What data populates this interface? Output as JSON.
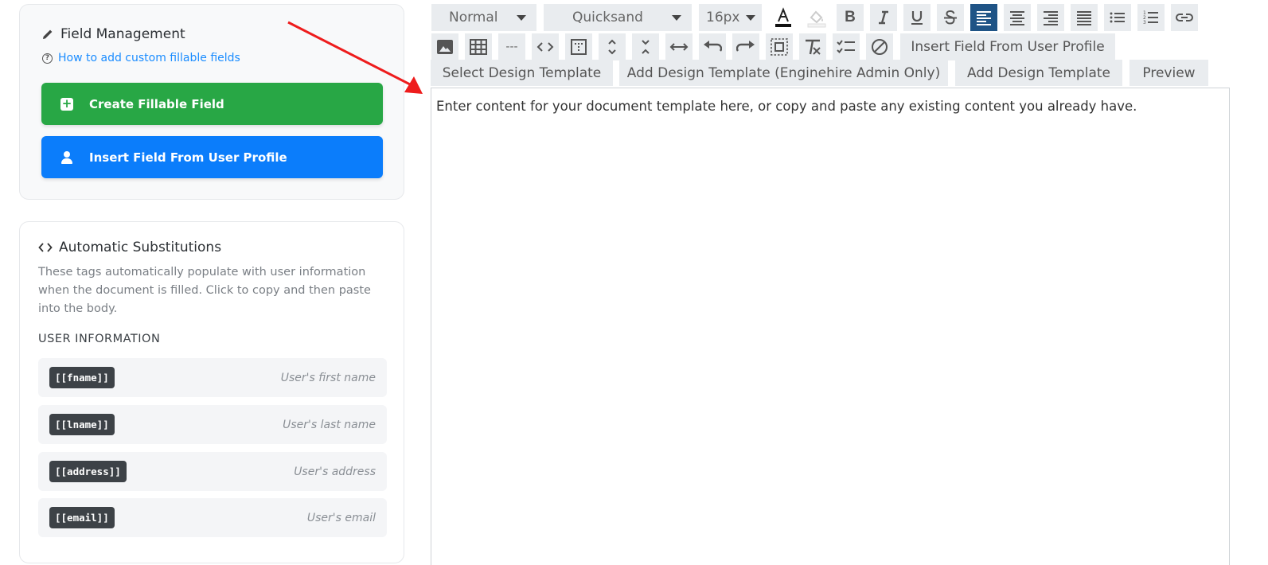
{
  "field_management": {
    "title": "Field Management",
    "help_link": "How to add custom fillable fields",
    "create_button": "Create Fillable Field",
    "insert_button": "Insert Field From User Profile"
  },
  "auto_subs": {
    "title": "Automatic Substitutions",
    "description": "These tags automatically populate with user information when the document is filled. Click to copy and then paste into the body.",
    "section_label": "USER INFORMATION",
    "tags": [
      {
        "tag": "[[fname]]",
        "desc": "User's first name"
      },
      {
        "tag": "[[lname]]",
        "desc": "User's last name"
      },
      {
        "tag": "[[address]]",
        "desc": "User's address"
      },
      {
        "tag": "[[email]]",
        "desc": "User's email"
      }
    ]
  },
  "toolbar": {
    "format_value": "Normal",
    "font_value": "Quicksand",
    "size_value": "16px",
    "horizontal_rule_label": "---",
    "insert_field_label": "Insert Field From User Profile"
  },
  "tabs": {
    "select_template": "Select Design Template",
    "add_template_admin": "Add Design Template (Enginehire Admin Only)",
    "add_template": "Add Design Template",
    "preview": "Preview"
  },
  "editor": {
    "content": "Enter content for your document template here, or copy and paste any existing content you already have."
  },
  "colors": {
    "green": "#28a745",
    "blue": "#0b7dfb",
    "active_align": "#1f5486",
    "arrow": "#ee1c1c"
  }
}
